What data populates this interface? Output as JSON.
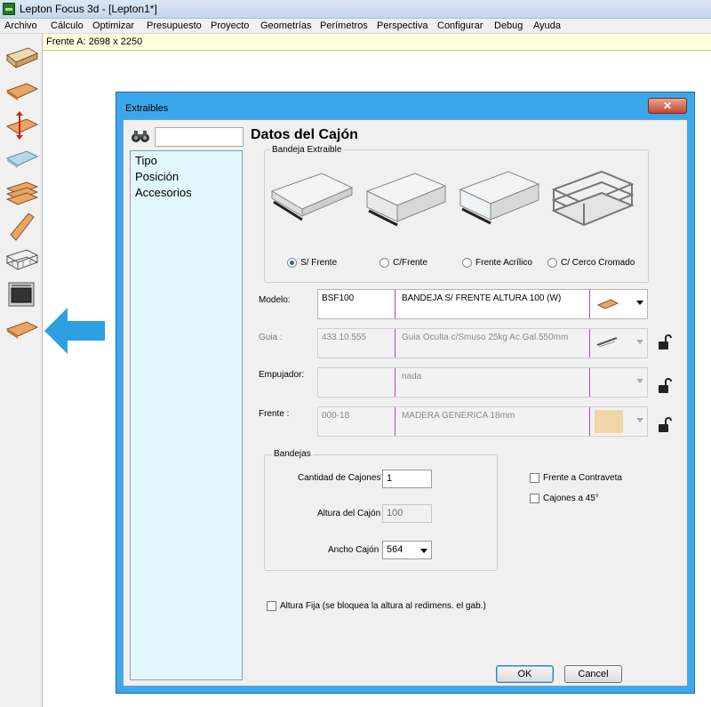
{
  "app": {
    "title": "Lepton Focus 3d - [Lepton1*]",
    "icon": "lepton-app-icon"
  },
  "menu": [
    "Archivo",
    "Cálculo",
    "Optimizar",
    "Presupuesto",
    "Proyecto",
    "Geometrías",
    "Perímetros",
    "Perspectiva",
    "Configurar",
    "Debug",
    "Ayuda"
  ],
  "toolbar": {
    "tools": [
      "drawer-box-icon",
      "shelf-board-icon",
      "height-adjust-board-icon",
      "glass-shelf-icon",
      "stacked-boards-icon",
      "side-panel-icon",
      "wire-basket-icon",
      "oven-icon",
      "pull-out-tray-icon"
    ]
  },
  "status": {
    "front": "Frente A: 2698 x 2250"
  },
  "colors": {
    "accent_blue": "#2e9fe0",
    "dialog_frame": "#3ba8ec",
    "tree_bg": "#e2f7fb"
  },
  "dialog": {
    "title": "Extraibles",
    "close": "✕",
    "tree": [
      "Tipo",
      "Posición",
      "Accesorios"
    ],
    "section_title": "Datos del Cajón",
    "bandeja": {
      "group_label": "Bandeja Extraible",
      "options": [
        "S/ Frente",
        "C/Frente",
        "Frente Acrílico",
        "C/ Cerco Cromado"
      ],
      "selected": "S/ Frente"
    },
    "modelo": {
      "label": "Modelo:",
      "code": "BSF100",
      "description": "BANDEJA S/ FRENTE ALTURA 100 (W)"
    },
    "guia": {
      "label": "Guia :",
      "code": "433.10.555",
      "description": "Guia Oculta c/Smuso 25kg Ac.Gal.550mm"
    },
    "empujador": {
      "label": "Empujador:",
      "code": "",
      "description": "nada"
    },
    "frente": {
      "label": "Frente :",
      "code": "000-18",
      "description": "MADERA GENERICA 18mm",
      "swatch_color": "#f2d6a8"
    },
    "bandejas": {
      "group_label": "Bandejas",
      "cantidad_label": "Cantidad de Cajones",
      "cantidad_value": "1",
      "altura_label": "Altura del Cajón",
      "altura_value": "100",
      "ancho_label": "Ancho Cajón",
      "ancho_value": "564"
    },
    "checks": {
      "frente_contraveta": "Frente a Contraveta",
      "cajones_45": "Cajones a 45°",
      "altura_fija": "Altura Fija (se bloquea la altura al redimens. el gab.)"
    },
    "buttons": {
      "ok": "OK",
      "cancel": "Cancel"
    }
  }
}
